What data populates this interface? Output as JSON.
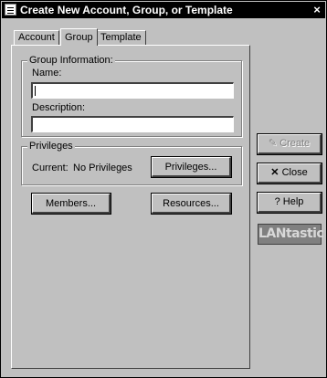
{
  "window": {
    "title": "Create New Account, Group, or Template",
    "close_glyph": "×"
  },
  "tabs": [
    {
      "label": "Account",
      "active": false
    },
    {
      "label": "Group",
      "active": true
    },
    {
      "label": "Template",
      "active": false
    }
  ],
  "group_info": {
    "legend": "Group Information:",
    "name_label": "Name:",
    "name_value": "",
    "description_label": "Description:",
    "description_value": ""
  },
  "privileges": {
    "legend": "Privileges",
    "current_label": "Current:",
    "current_value": "No Privileges",
    "button_label": "Privileges..."
  },
  "buttons": {
    "members": "Members...",
    "resources": "Resources..."
  },
  "side_buttons": {
    "create": "Create",
    "close": "Close",
    "help": "Help"
  },
  "logo": {
    "text": "LANtastic"
  },
  "icons": {
    "create": "pencil-icon",
    "close": "x-icon",
    "help": "question-icon"
  }
}
